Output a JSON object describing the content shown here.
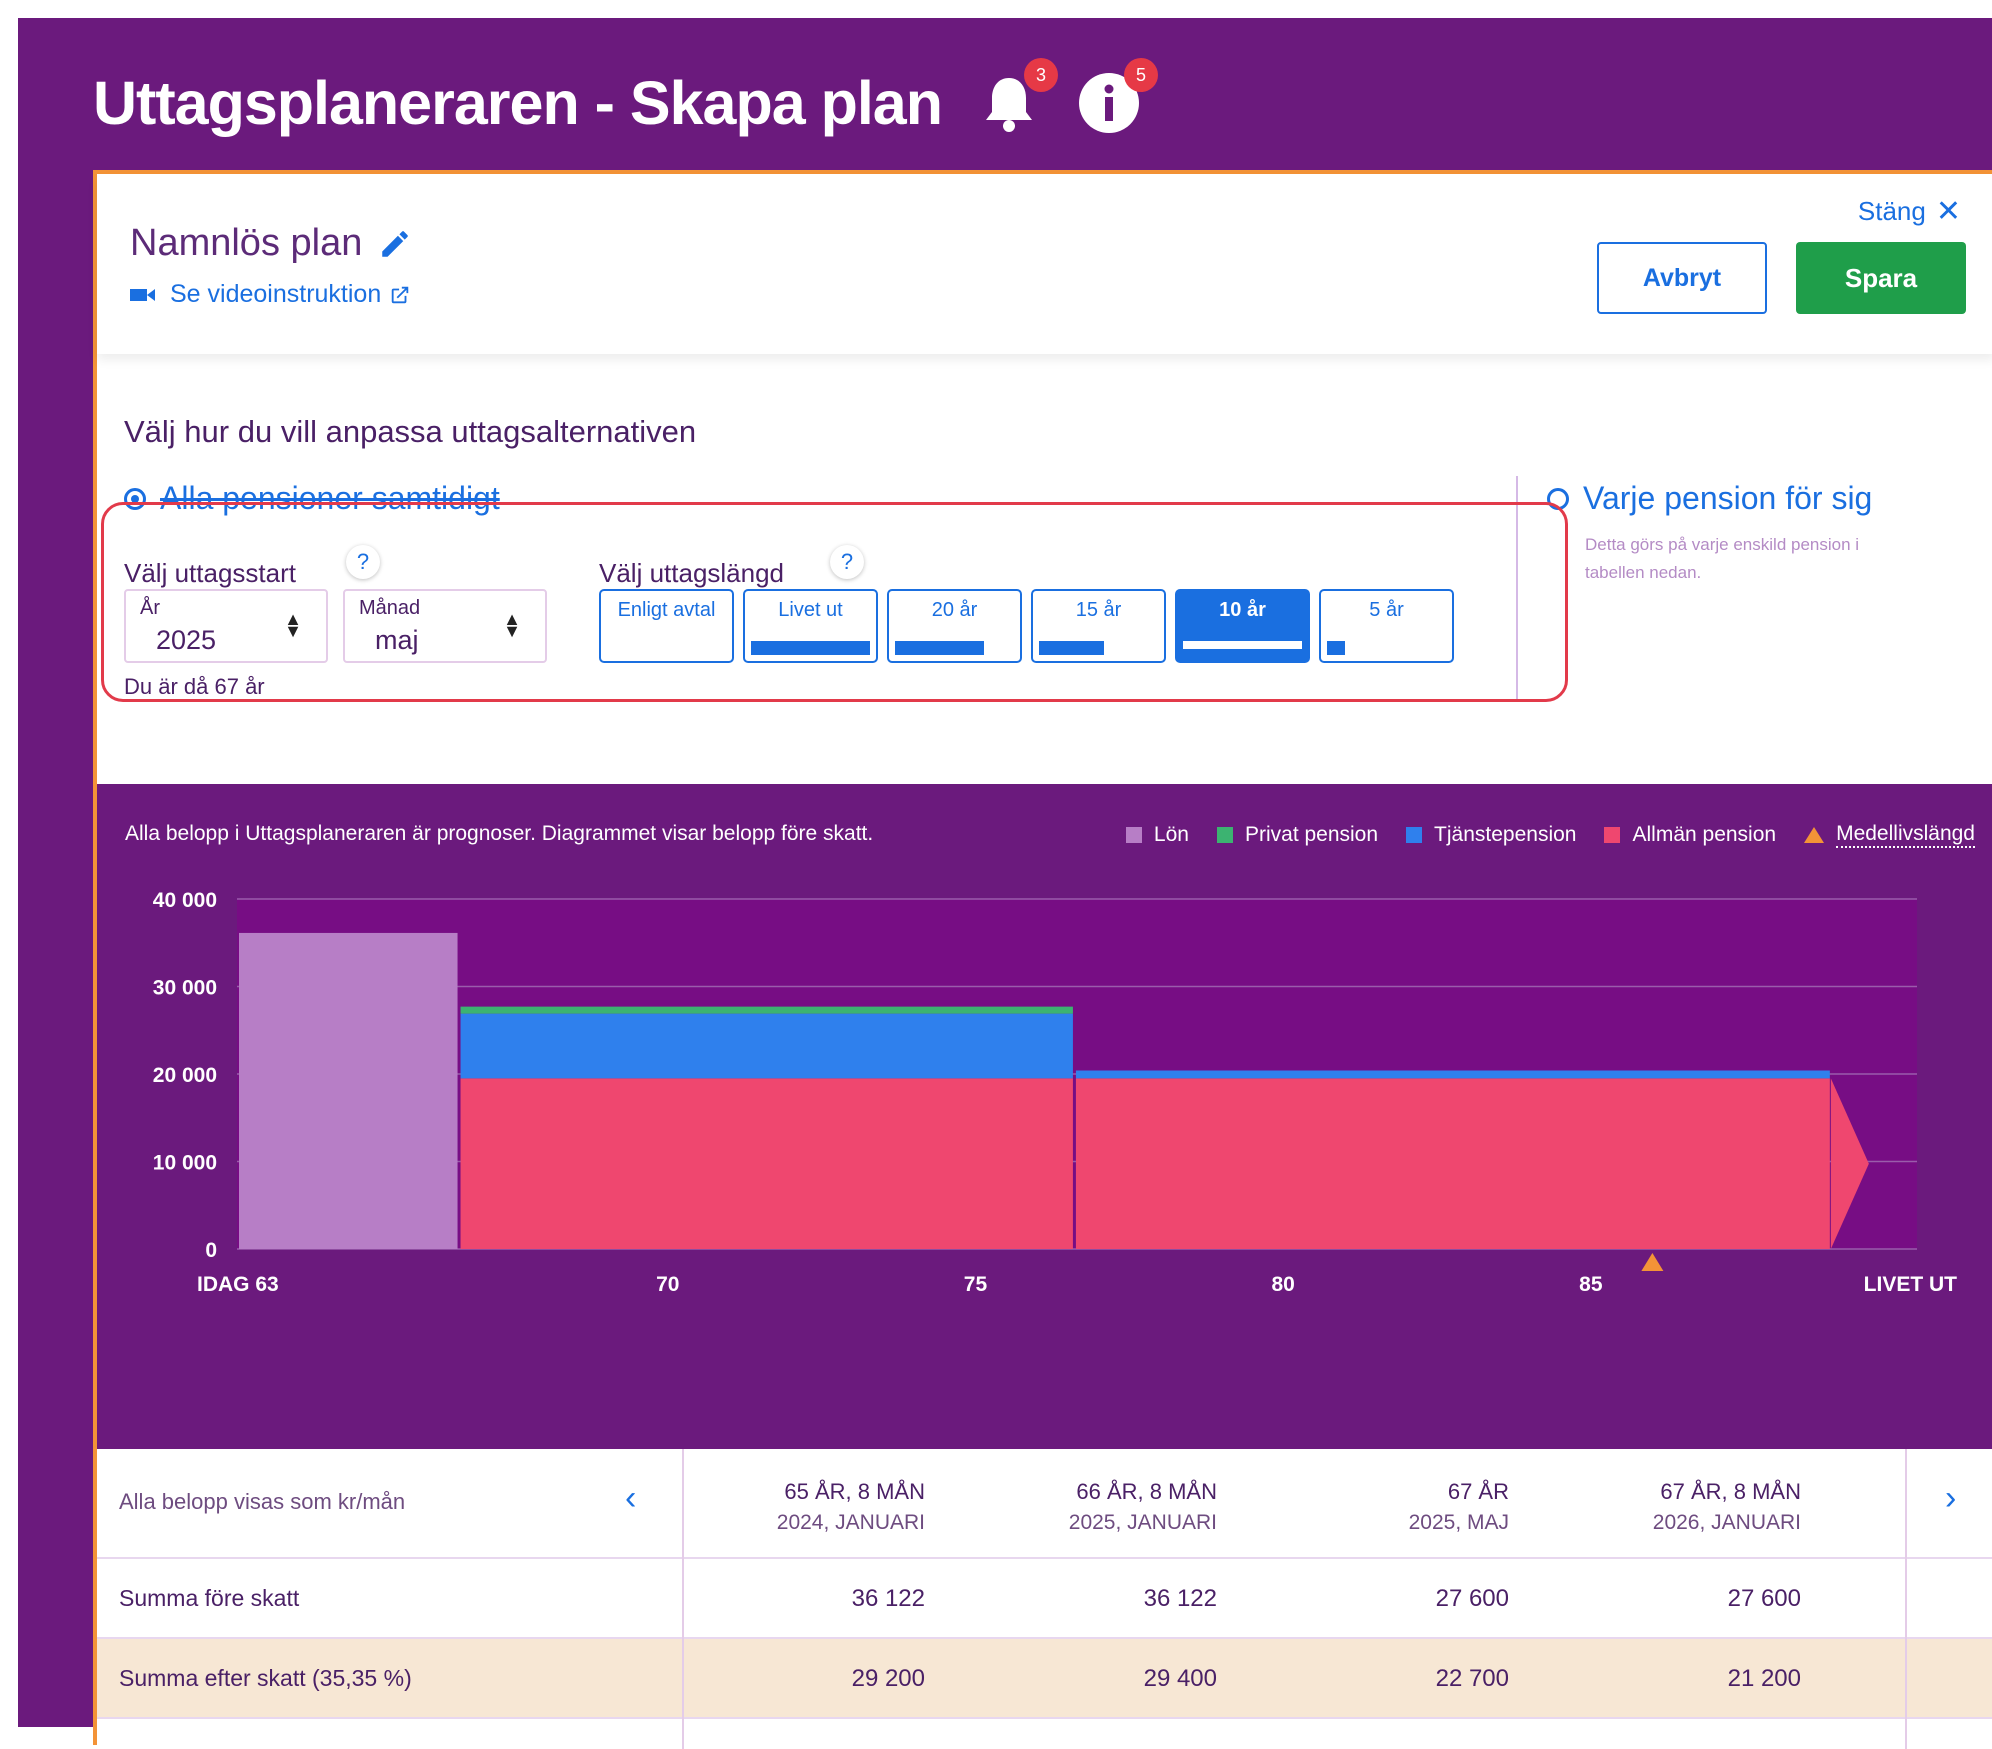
{
  "header": {
    "title": "Uttagsplaneraren - Skapa plan",
    "notifications_count": "3",
    "info_count": "5"
  },
  "plan": {
    "name": "Namnlös plan",
    "video_link": "Se videoinstruktion",
    "close_label": "Stäng",
    "cancel_label": "Avbryt",
    "save_label": "Spara"
  },
  "options": {
    "heading": "Välj hur du vill anpassa uttagsalternativen",
    "all_label": "Alla pensioner samtidigt",
    "each_label": "Varje pension för sig",
    "each_desc": "Detta görs på varje enskild pension i tabellen nedan.",
    "start_label": "Välj uttagsstart",
    "year_label": "År",
    "year_value": "2025",
    "month_label": "Månad",
    "month_value": "maj",
    "age_note": "Du är då 67 år",
    "length_label": "Välj uttagslängd",
    "help": "?",
    "lengths": [
      {
        "label": "Enligt avtal",
        "fill": 0
      },
      {
        "label": "Livet ut",
        "fill": 1.0
      },
      {
        "label": "20 år",
        "fill": 0.75
      },
      {
        "label": "15 år",
        "fill": 0.55
      },
      {
        "label": "10 år",
        "fill": 0.35
      },
      {
        "label": "5 år",
        "fill": 0.15
      }
    ],
    "selected_length": "10 år"
  },
  "chart_note": "Alla belopp i Uttagsplaneraren är prognoser. Diagrammet visar belopp före skatt.",
  "legend": [
    {
      "label": "Lön",
      "color": "#b77ec6"
    },
    {
      "label": "Privat pension",
      "color": "#3cb371"
    },
    {
      "label": "Tjänstepension",
      "color": "#2f80ed"
    },
    {
      "label": "Allmän pension",
      "color": "#ef476f"
    }
  ],
  "legend_marker": {
    "label": "Medellivslängd",
    "color": "#f39337"
  },
  "chart_data": {
    "type": "area",
    "ylim": [
      0,
      40000
    ],
    "yticks": [
      "0",
      "10 000",
      "20 000",
      "30 000",
      "40 000"
    ],
    "xticks": [
      {
        "age": 63,
        "label": "IDAG 63"
      },
      {
        "age": 70,
        "label": "70"
      },
      {
        "age": 75,
        "label": "75"
      },
      {
        "age": 80,
        "label": "80"
      },
      {
        "age": 85,
        "label": "85"
      },
      {
        "age": 90.3,
        "label": "LIVET UT"
      }
    ],
    "life_expectancy_age": 86,
    "segments": [
      {
        "from": 63,
        "to": 66.6,
        "stack": [
          {
            "series": "Lön",
            "value": 36122
          }
        ]
      },
      {
        "from": 66.6,
        "to": 76.6,
        "stack": [
          {
            "series": "Allmän pension",
            "value": 19500
          },
          {
            "series": "Tjänstepension",
            "value": 7400
          },
          {
            "series": "Privat pension",
            "value": 800
          }
        ]
      },
      {
        "from": 76.6,
        "to": 88.9,
        "stack": [
          {
            "series": "Allmän pension",
            "value": 19500
          },
          {
            "series": "Tjänstepension",
            "value": 900
          }
        ]
      }
    ]
  },
  "table": {
    "units_note": "Alla belopp visas som kr/mån",
    "columns": [
      {
        "age": "65 ÅR, 8 MÅN",
        "date": "2024, JANUARI"
      },
      {
        "age": "66 ÅR, 8 MÅN",
        "date": "2025, JANUARI"
      },
      {
        "age": "67 ÅR",
        "date": "2025, MAJ"
      },
      {
        "age": "67 ÅR, 8 MÅN",
        "date": "2026, JANUARI"
      }
    ],
    "rows": [
      {
        "label": "Summa före skatt",
        "values": [
          "36 122",
          "36 122",
          "27 600",
          "27 600"
        ]
      },
      {
        "label": "Summa efter skatt (35,35 %)",
        "values": [
          "29 200",
          "29 400",
          "22 700",
          "21 200"
        ]
      }
    ]
  }
}
